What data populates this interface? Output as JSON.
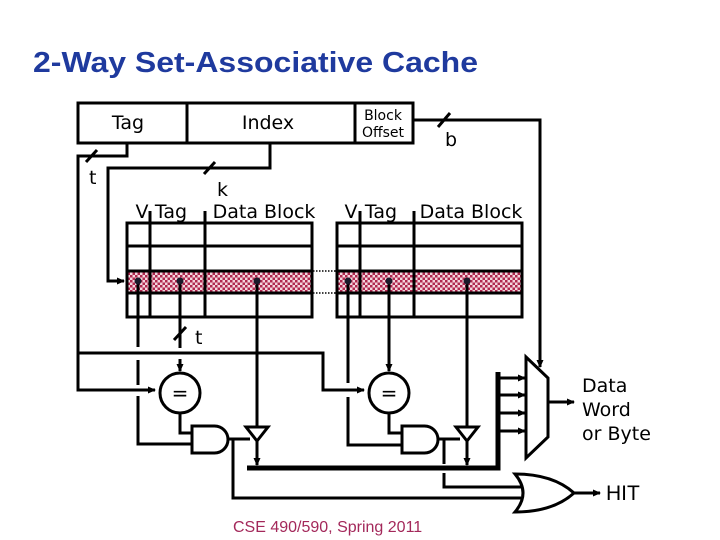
{
  "title": "2-Way Set-Associative Cache",
  "address": {
    "tag": "Tag",
    "index": "Index",
    "block_offset_line1": "Block",
    "block_offset_line2": "Offset"
  },
  "bit_widths": {
    "tag": "t",
    "index": "k",
    "offset": "b",
    "tag_compare": "t"
  },
  "ways": [
    {
      "valid": "V",
      "tag": "Tag",
      "data": "Data Block"
    },
    {
      "valid": "V",
      "tag": "Tag",
      "data": "Data Block"
    }
  ],
  "rows_per_way": 4,
  "selected_row": 3,
  "comparator_symbol": "=",
  "outputs": {
    "data_line1": "Data",
    "data_line2": "Word",
    "data_line3": "or Byte",
    "hit": "HIT"
  },
  "footer": "CSE 490/590, Spring 2011",
  "colors": {
    "title": "#1f3a9e",
    "footer": "#a3285a",
    "selected_row_dots": "#b0284f",
    "selected_row_bg": "#f3d6de"
  }
}
